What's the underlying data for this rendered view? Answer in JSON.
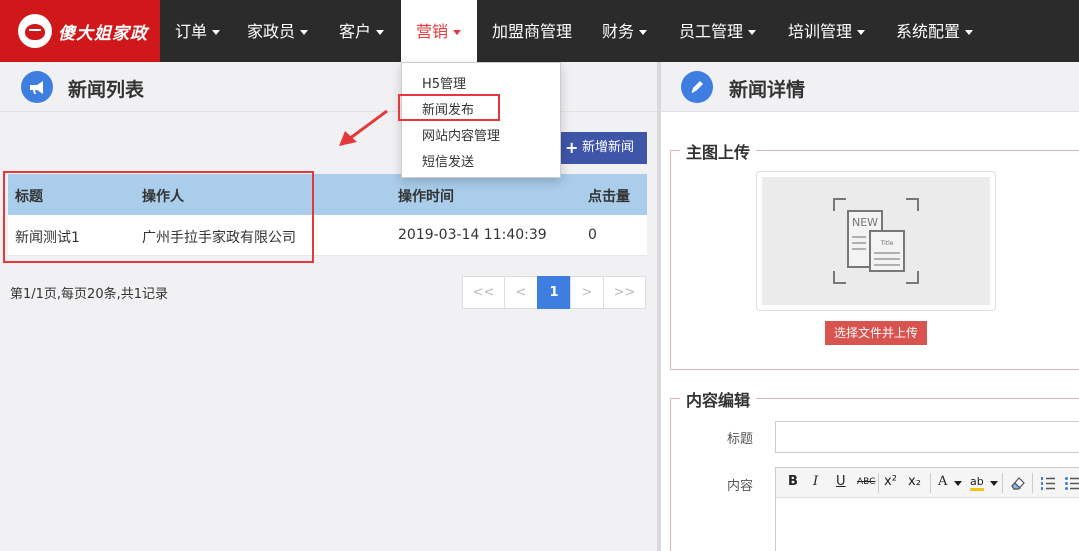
{
  "brand": {
    "name": "傻大姐家政"
  },
  "nav": {
    "items": [
      {
        "label": "订单",
        "caret": true
      },
      {
        "label": "家政员",
        "caret": true
      },
      {
        "label": "客户",
        "caret": true
      },
      {
        "label": "营销",
        "caret": true,
        "active": true
      },
      {
        "label": "加盟商管理",
        "caret": false
      },
      {
        "label": "财务",
        "caret": true
      },
      {
        "label": "员工管理",
        "caret": true
      },
      {
        "label": "培训管理",
        "caret": true
      },
      {
        "label": "系统配置",
        "caret": true
      }
    ]
  },
  "dropdown": {
    "items": [
      {
        "label": "H5管理"
      },
      {
        "label": "新闻发布",
        "highlighted": true
      },
      {
        "label": "网站内容管理"
      },
      {
        "label": "短信发送"
      }
    ]
  },
  "left_panel": {
    "title": "新闻列表",
    "icon": "megaphone-icon",
    "add_button": "新增新闻",
    "table": {
      "headers": [
        "标题",
        "操作人",
        "操作时间",
        "点击量"
      ],
      "rows": [
        {
          "title": "新闻测试1",
          "operator": "广州手拉手家政有限公司",
          "time": "2019-03-14 11:40:39",
          "clicks": "0"
        }
      ]
    },
    "page_info": "第1/1页,每页20条,共1记录",
    "pager": {
      "first": "<<",
      "prev": "<",
      "current": "1",
      "next": ">",
      "last": ">>"
    }
  },
  "right_panel": {
    "title": "新闻详情",
    "icon": "pencil-icon",
    "image_section": {
      "legend": "主图上传",
      "upload_button": "选择文件并上传",
      "placeholder_badge": "NEW",
      "placeholder_small": "Title"
    },
    "content_section": {
      "legend": "内容编辑",
      "title_label": "标题",
      "title_value": "",
      "content_label": "内容",
      "toolbar": [
        "B",
        "I",
        "U",
        "ABC",
        "x²",
        "x₂",
        "A",
        "ab"
      ]
    }
  },
  "colors": {
    "navbar": "#2b2b2b",
    "brand_red": "#d0171a",
    "active_text": "#e4393c",
    "primary_blue": "#3d7ee0",
    "add_button": "#3e55a8",
    "table_head": "#a9cdeb",
    "upload_button": "#d9534f",
    "annotation_red": "#e4393c"
  }
}
